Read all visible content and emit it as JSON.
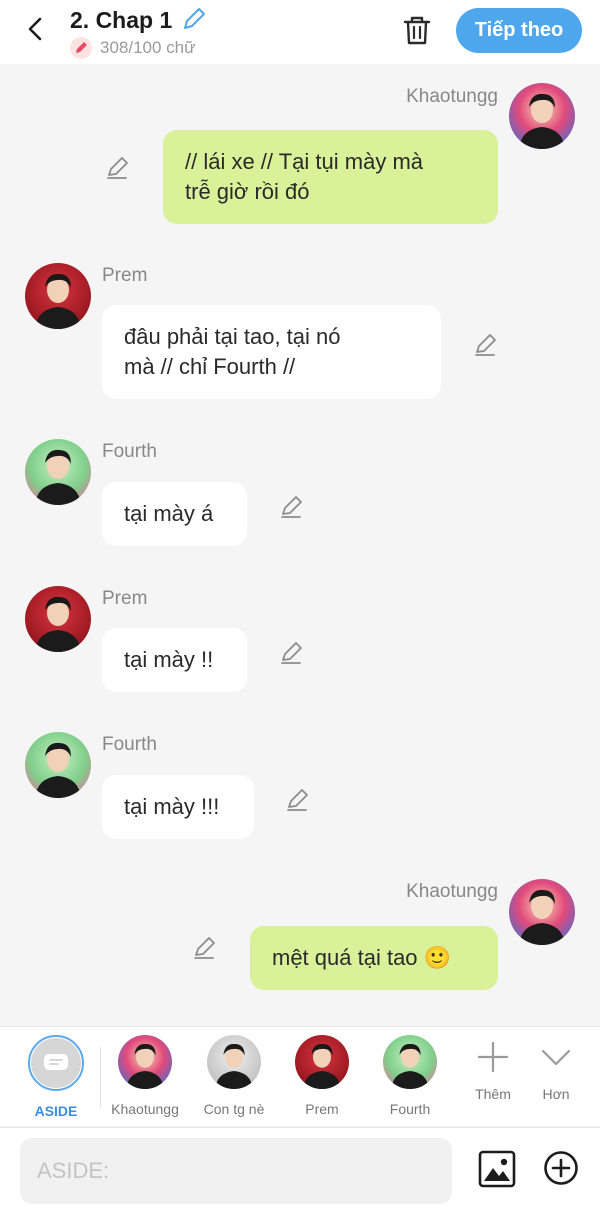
{
  "header": {
    "title": "2. Chap 1",
    "word_count": "308/100 chữ",
    "next_label": "Tiếp theo"
  },
  "messages": [
    {
      "sender": "Khaotungg",
      "side": "right",
      "text_lines": [
        "// lái xe // Tại tụi mày mà",
        "trễ giờ rồi đó"
      ]
    },
    {
      "sender": "Prem",
      "side": "left",
      "text_lines": [
        "đâu phải tại tao, tại nó",
        "mà // chỉ Fourth //"
      ]
    },
    {
      "sender": "Fourth",
      "side": "left",
      "text_lines": [
        "tại mày á"
      ]
    },
    {
      "sender": "Prem",
      "side": "left",
      "text_lines": [
        "tại mày !!"
      ]
    },
    {
      "sender": "Fourth",
      "side": "left",
      "text_lines": [
        "tại mày !!!"
      ]
    },
    {
      "sender": "Khaotungg",
      "side": "right",
      "text_lines": [
        "mệt quá tại tao 🙂"
      ]
    }
  ],
  "characters": [
    {
      "label": "ASIDE",
      "active": true
    },
    {
      "label": "Khaotungg"
    },
    {
      "label": "Con tg nè"
    },
    {
      "label": "Prem"
    },
    {
      "label": "Fourth"
    }
  ],
  "tools": {
    "add_label": "Thêm",
    "more_label": "Hơn"
  },
  "composer": {
    "placeholder": "ASIDE:"
  },
  "colors": {
    "accent": "#4ea6ec",
    "my_bubble": "#d9f29a",
    "other_bubble": "#ffffff",
    "background": "#f5f5f5"
  }
}
